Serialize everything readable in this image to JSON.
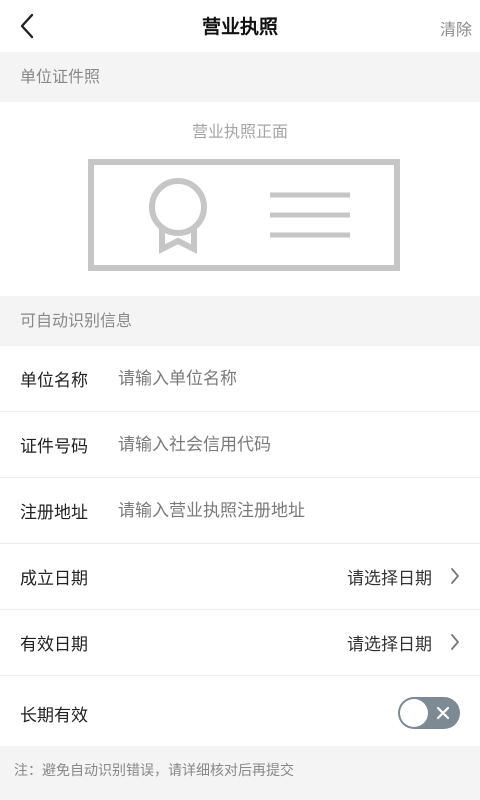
{
  "header": {
    "title": "营业执照",
    "clear_label": "清除"
  },
  "section_photo": {
    "title": "单位证件照",
    "upload_caption": "营业执照正面"
  },
  "section_info": {
    "title": "可自动识别信息"
  },
  "fields": {
    "unit_name": {
      "label": "单位名称",
      "placeholder": "请输入单位名称"
    },
    "cert_number": {
      "label": "证件号码",
      "placeholder": "请输入社会信用代码"
    },
    "reg_address": {
      "label": "注册地址",
      "placeholder": "请输入营业执照注册地址"
    },
    "established_date": {
      "label": "成立日期",
      "value": "请选择日期"
    },
    "valid_date": {
      "label": "有效日期",
      "value": "请选择日期"
    },
    "long_term": {
      "label": "长期有效",
      "enabled": false
    }
  },
  "footer": {
    "note": "注：避免自动识别错误，请详细核对后再提交"
  },
  "colors": {
    "section_bg": "#f4f4f4",
    "toggle_off": "#7d8a93",
    "muted_text": "#888888"
  }
}
